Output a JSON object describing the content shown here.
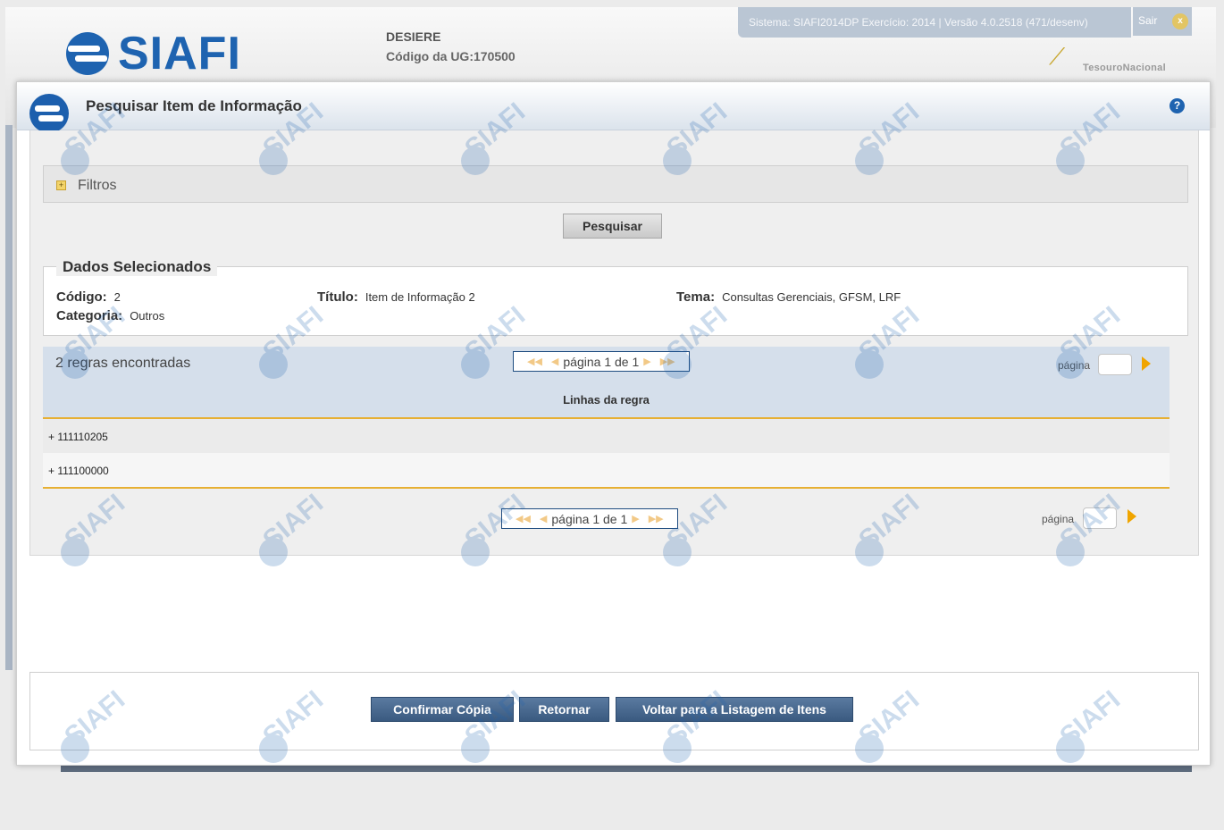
{
  "app": {
    "logo_text": "SIAFI",
    "org_name": "DESIERE",
    "ug_label": "Código da UG:",
    "ug_value": "170500",
    "system_info": "Sistema: SIAFI2014DP Exercício: 2014 | Versão 4.0.2518 (471/desenv)",
    "sair_label": "Sair",
    "sair_icon": "x",
    "tesouro_label": "TesouroNacional"
  },
  "modal": {
    "title": "Pesquisar Item de Informação",
    "help_icon": "?",
    "filtros": {
      "icon": "+",
      "label": "Filtros"
    },
    "search_button": "Pesquisar",
    "dados": {
      "legend": "Dados Selecionados",
      "codigo_label": "Código:",
      "codigo_value": "2",
      "titulo_label": "Título:",
      "titulo_value": "Item de Informação 2",
      "tema_label": "Tema:",
      "tema_value": "Consultas Gerenciais, GFSM, LRF",
      "categoria_label": "Categoria:",
      "categoria_value": "Outros"
    },
    "grid": {
      "count_text": "2 regras encontradas",
      "pager_text": "página 1 de 1",
      "page_label": "página",
      "column_header": "Linhas da regra",
      "rows": [
        "+ 111110205",
        "+ 111100000"
      ]
    },
    "footer_buttons": {
      "confirm": "Confirmar Cópia",
      "return": "Retornar",
      "back_to_list": "Voltar para a Listagem de Itens"
    }
  },
  "watermark_text": "SIAFI",
  "colors": {
    "brand_blue": "#1e63b0",
    "header_band": "#d5dfeb",
    "accent_orange": "#f0a500",
    "button_blue": "#3a5a80"
  }
}
